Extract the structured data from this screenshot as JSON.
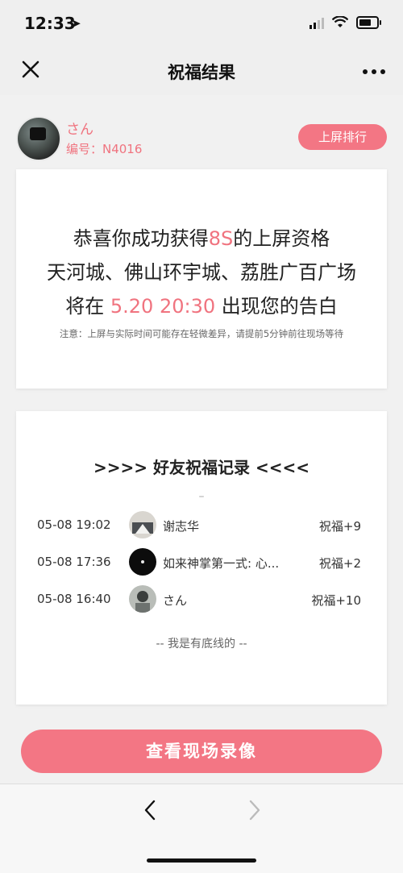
{
  "status_bar": {
    "time": "12:33",
    "location_arrow": "➤"
  },
  "nav": {
    "title": "祝福结果",
    "close_icon": "close-icon",
    "more_icon": "more-icon"
  },
  "user": {
    "name": "さん",
    "id_label": "编号：N4016",
    "rank_button": "上屏排行"
  },
  "info_card": {
    "line1_prefix": "恭喜你成功获得",
    "line1_highlight": "8S",
    "line1_suffix": "的上屏资格",
    "line2": "天河城、佛山环宇城、荔胜广百广场",
    "line3_prefix": "将在 ",
    "line3_highlight": "5.20 20:30",
    "line3_suffix": " 出现您的告白",
    "note": "注意：上屏与实际时间可能存在轻微差异，请提前5分钟前往现场等待"
  },
  "record_card": {
    "title": ">>>> 好友祝福记录 <<<<",
    "dash": "–",
    "rows": [
      {
        "time": "05-08 19:02",
        "name": "谢志华",
        "bless": "祝福+9"
      },
      {
        "time": "05-08 17:36",
        "name": "如来神掌第一式: 心...",
        "bless": "祝福+2"
      },
      {
        "time": "05-08 16:40",
        "name": "さん",
        "bless": "祝福+10"
      }
    ],
    "footer": "-- 我是有底线的 --"
  },
  "video_button": "查看现场录像",
  "colors": {
    "accent": "#f37684",
    "accent_text": "#f0737f"
  }
}
